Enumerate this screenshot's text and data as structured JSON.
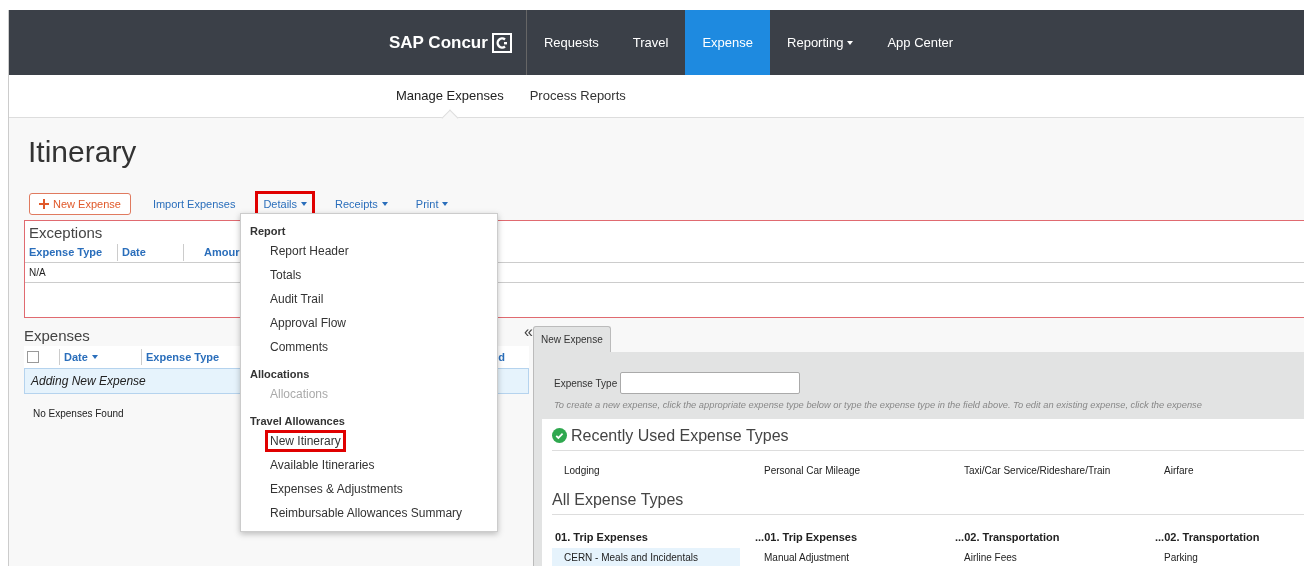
{
  "brand": "SAP Concur",
  "nav": [
    {
      "label": "Requests",
      "selected": false,
      "has_menu": false
    },
    {
      "label": "Travel",
      "selected": false,
      "has_menu": false
    },
    {
      "label": "Expense",
      "selected": true,
      "has_menu": false
    },
    {
      "label": "Reporting",
      "selected": false,
      "has_menu": true
    },
    {
      "label": "App Center",
      "selected": false,
      "has_menu": false
    }
  ],
  "subnav": [
    {
      "label": "Manage Expenses",
      "selected": true
    },
    {
      "label": "Process Reports",
      "selected": false
    }
  ],
  "page_title": "Itinerary",
  "toolbar": [
    {
      "kind": "button",
      "label": "New Expense"
    },
    {
      "kind": "link",
      "label": "Import Expenses",
      "has_menu": false,
      "highlighted": false
    },
    {
      "kind": "link",
      "label": "Details",
      "has_menu": true,
      "highlighted": true
    },
    {
      "kind": "link",
      "label": "Receipts",
      "has_menu": true,
      "highlighted": false
    },
    {
      "kind": "link",
      "label": "Print",
      "has_menu": true,
      "highlighted": false
    }
  ],
  "exceptions": {
    "title": "Exceptions",
    "columns": [
      "Expense Type",
      "Date",
      "Amour"
    ],
    "rows": [
      [
        "N/A"
      ]
    ]
  },
  "expenses": {
    "title": "Expenses",
    "collapse": "«",
    "select_all_checked": false,
    "columns": [
      {
        "label": "Date",
        "sorted": true
      },
      {
        "label": "Expense Type",
        "sorted": false
      },
      {
        "label": "d",
        "sorted": false
      }
    ],
    "new_row": "Adding New Expense",
    "empty_message": "No Expenses Found"
  },
  "details_menu": {
    "sections": [
      {
        "title": "Report",
        "items": [
          {
            "label": "Report Header",
            "disabled": false,
            "highlighted": false
          },
          {
            "label": "Totals",
            "disabled": false,
            "highlighted": false
          },
          {
            "label": "Audit Trail",
            "disabled": false,
            "highlighted": false
          },
          {
            "label": "Approval Flow",
            "disabled": false,
            "highlighted": false
          },
          {
            "label": "Comments",
            "disabled": false,
            "highlighted": false
          }
        ]
      },
      {
        "title": "Allocations",
        "items": [
          {
            "label": "Allocations",
            "disabled": true,
            "highlighted": false
          }
        ]
      },
      {
        "title": "Travel Allowances",
        "items": [
          {
            "label": "New Itinerary",
            "disabled": false,
            "highlighted": true
          },
          {
            "label": "Available Itineraries",
            "disabled": false,
            "highlighted": false
          },
          {
            "label": "Expenses & Adjustments",
            "disabled": false,
            "highlighted": false
          },
          {
            "label": "Reimbursable Allowances Summary",
            "disabled": false,
            "highlighted": false
          }
        ]
      }
    ]
  },
  "new_expense": {
    "tab": "New Expense",
    "field_label": "Expense Type",
    "hint": "To create a new expense, click the appropriate expense type below or type the expense type in the field above. To edit an existing expense, click the expense",
    "recent_title": "Recently Used Expense Types",
    "recent": [
      "Lodging",
      "Personal Car Mileage",
      "Taxi/Car Service/Rideshare/Train",
      "Airfare"
    ],
    "all_title": "All Expense Types",
    "all_columns": [
      {
        "heading": "01. Trip Expenses",
        "items": [
          {
            "label": "CERN - Meals and Incidentals",
            "selected": true
          }
        ]
      },
      {
        "heading": "...01. Trip Expenses",
        "items": [
          {
            "label": "Manual Adjustment",
            "selected": false
          }
        ]
      },
      {
        "heading": "...02. Transportation",
        "items": [
          {
            "label": "Airline Fees",
            "selected": false
          }
        ]
      },
      {
        "heading": "...02. Transportation",
        "items": [
          {
            "label": "Parking",
            "selected": false
          }
        ]
      }
    ]
  }
}
